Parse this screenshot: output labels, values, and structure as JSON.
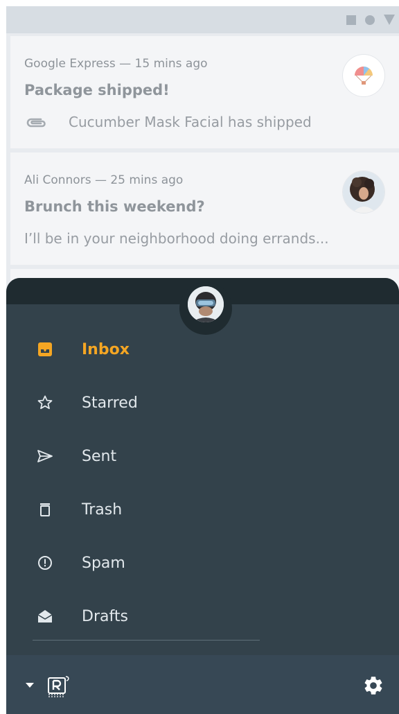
{
  "emails": [
    {
      "meta": "Google Express — 15 mins ago",
      "subject": "Package shipped!",
      "preview": "Cucumber Mask Facial has shipped"
    },
    {
      "meta": "Ali Connors — 25 mins ago",
      "subject": "Brunch this weekend?",
      "preview": "I’ll be in your neighborhood doing errands..."
    }
  ],
  "nav": {
    "items": [
      {
        "label": "Inbox",
        "icon": "inbox-icon",
        "active": true
      },
      {
        "label": "Starred",
        "icon": "star-icon"
      },
      {
        "label": "Sent",
        "icon": "send-icon"
      },
      {
        "label": "Trash",
        "icon": "trash-icon"
      },
      {
        "label": "Spam",
        "icon": "spam-icon"
      },
      {
        "label": "Drafts",
        "icon": "drafts-icon"
      }
    ]
  },
  "colors": {
    "accent": "#f5a623",
    "drawer_bg": "#33424b",
    "drawer_header": "#1f2b30",
    "bottom_bar": "#374855",
    "card_bg": "#f4f5f7"
  },
  "icons": {
    "status": [
      "square-icon",
      "circle-icon",
      "triangle-icon"
    ],
    "bottom_bar": [
      "dropdown-arrow-icon",
      "reply-logo-icon",
      "settings-gear-icon"
    ]
  }
}
